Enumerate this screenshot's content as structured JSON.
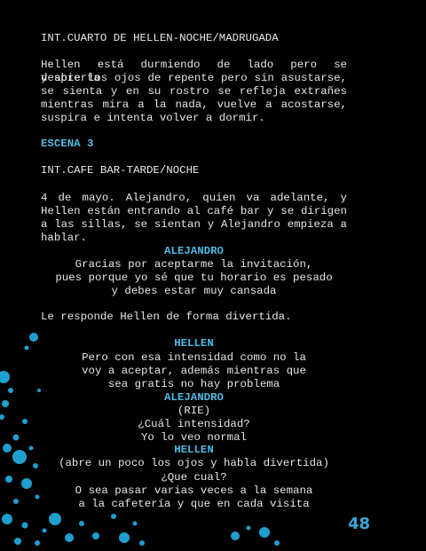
{
  "script": {
    "heading1": "INT.CUARTO DE HELLEN-NOCHE/MADRUGADA",
    "action1": [
      "Hellen está durmiendo de lado pero se despierta",
      "y abre los ojos de repente pero sin asustarse,",
      "se sienta y en su rostro se refleja extrañes",
      "mientras mira a la nada, vuelve a acostarse,",
      "suspira e intenta volver a dormir."
    ],
    "scene_label": "ESCENA 3",
    "heading2": "INT.CAFE BAR-TARDE/NOCHE",
    "action2": [
      "4 de mayo. Alejandro, quien va adelante, y",
      "Hellen están entrando al café bar y se dirigen",
      "a las sillas, se sientan y Alejandro empieza a",
      "hablar."
    ],
    "cue_alejandro_1": "ALEJANDRO",
    "dialogue_alejandro_1": [
      "Gracias por aceptarme la invitación,",
      "pues porque yo sé que tu horario es pesado",
      "y debes estar muy cansada"
    ],
    "action3": "Le responde Hellen de forma divertida.",
    "cue_hellen_1": "HELLEN",
    "dialogue_hellen_1": [
      "Pero con esa intensidad como no la",
      "voy a aceptar, además mientras que",
      "sea gratis no hay problema"
    ],
    "cue_alejandro_2": "ALEJANDRO",
    "paren_alejandro_2": "(RIE)",
    "dialogue_alejandro_2": [
      "¿Cuál intensidad?",
      "Yo lo veo normal"
    ],
    "cue_hellen_2": "HELLEN",
    "paren_hellen_2": "(abre un poco los ojos y habla divertida)",
    "dialogue_hellen_2": [
      "¿Que cual?",
      "O sea pasar varias veces a la semana",
      "a la cafetería y que en cada visita"
    ]
  },
  "page_number": "48",
  "colors": {
    "background": "#000000",
    "text": "#e6e6e6",
    "accent": "#3aa7d6"
  }
}
